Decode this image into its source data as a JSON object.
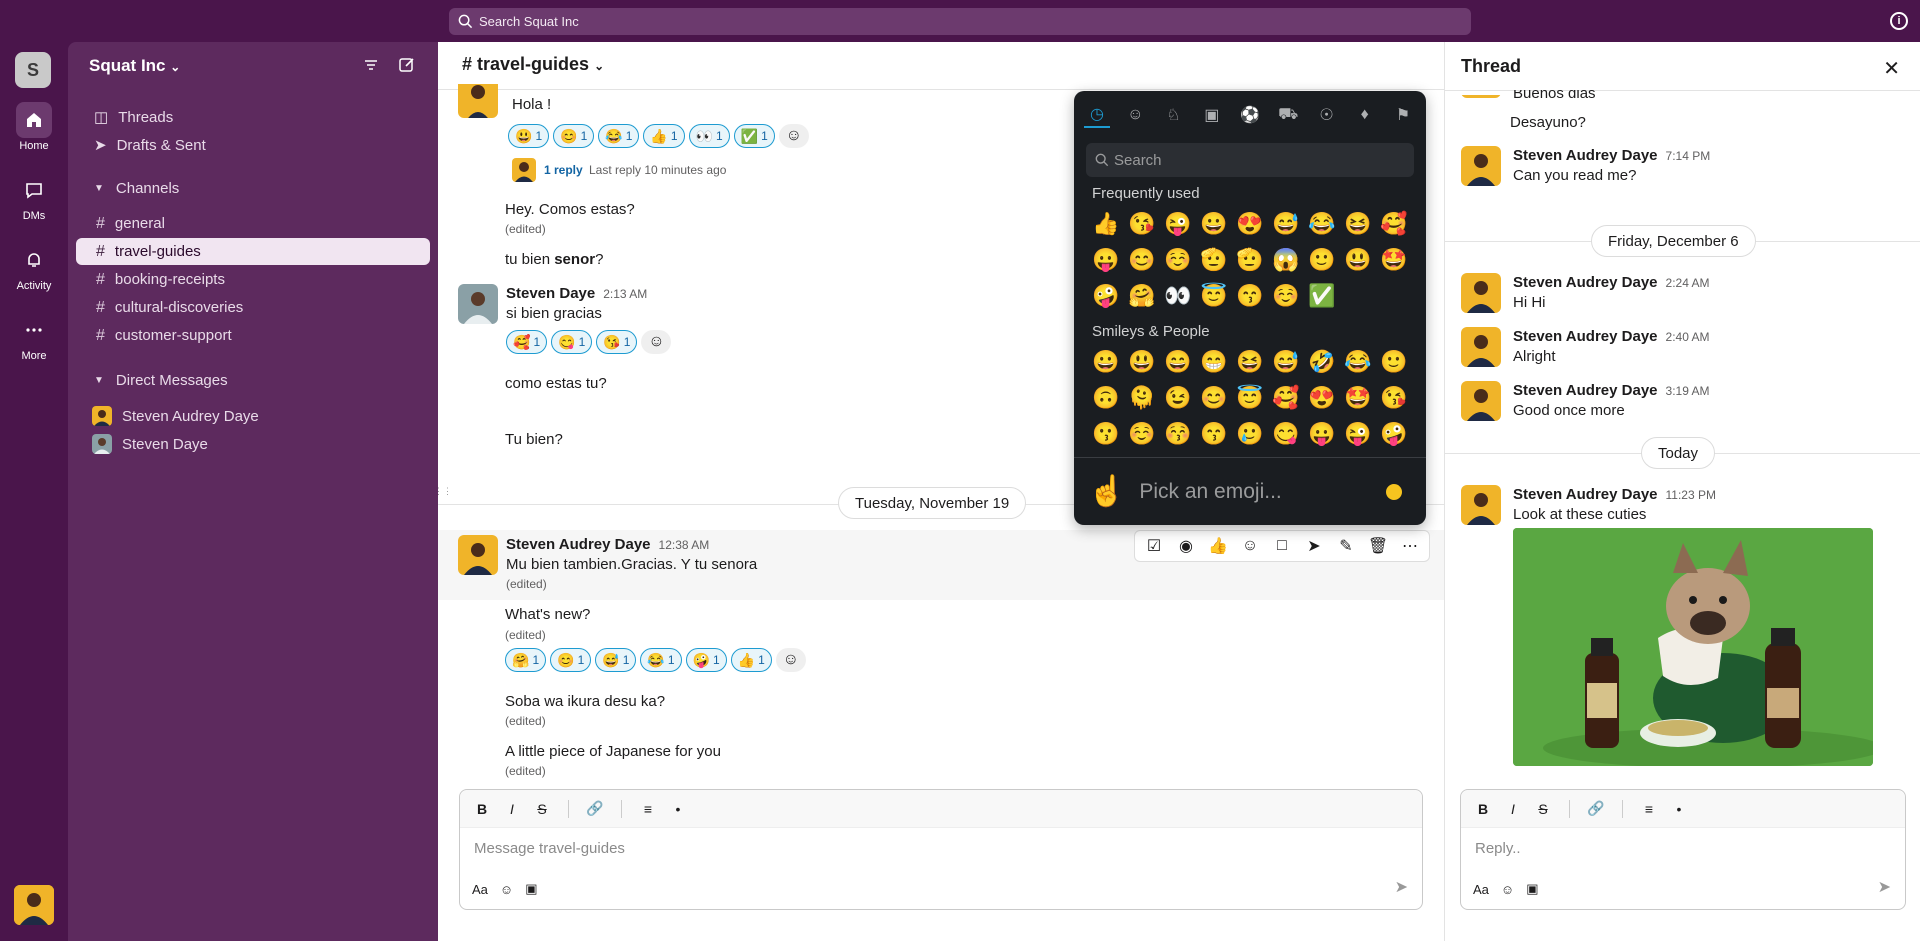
{
  "search": {
    "placeholder": "Search Squat Inc"
  },
  "rail": {
    "workspace_initial": "S",
    "items": [
      {
        "label": "Home"
      },
      {
        "label": "DMs"
      },
      {
        "label": "Activity"
      },
      {
        "label": "More"
      }
    ]
  },
  "sidebar": {
    "workspace": "Squat Inc",
    "nav": [
      {
        "label": "Threads"
      },
      {
        "label": "Drafts & Sent"
      }
    ],
    "channels_header": "Channels",
    "channels": [
      {
        "name": "general"
      },
      {
        "name": "travel-guides"
      },
      {
        "name": "booking-receipts"
      },
      {
        "name": "cultural-discoveries"
      },
      {
        "name": "customer-support"
      }
    ],
    "dm_header": "Direct Messages",
    "dms": [
      {
        "name": "Steven Audrey Daye"
      },
      {
        "name": "Steven Daye"
      }
    ]
  },
  "channel": {
    "title": "# travel-guides",
    "messages": {
      "m1_text": "Hola !",
      "m1_reactions": [
        {
          "emoji": "😃",
          "count": "1"
        },
        {
          "emoji": "😊",
          "count": "1"
        },
        {
          "emoji": "😂",
          "count": "1"
        },
        {
          "emoji": "👍",
          "count": "1"
        },
        {
          "emoji": "👀",
          "count": "1"
        },
        {
          "emoji": "✅",
          "count": "1"
        }
      ],
      "m1_reply": "1 reply",
      "m1_last_reply": "Last reply 10 minutes ago",
      "m2_text": "Hey. Comos estas?",
      "m2_edited": "(edited)",
      "m3_text_pre": "tu bien ",
      "m3_text_bold": "senor",
      "m3_text_post": "?",
      "m4_author": "Steven Daye",
      "m4_time": "2:13 AM",
      "m4_text": "si bien gracias",
      "m4_reactions": [
        {
          "emoji": "🥰",
          "count": "1"
        },
        {
          "emoji": "😋",
          "count": "1"
        },
        {
          "emoji": "😘",
          "count": "1"
        }
      ],
      "m5_text": "como estas tu?",
      "m6_text": "Tu bien?",
      "date_divider": "Tuesday, November 19",
      "m7_author": "Steven Audrey Daye",
      "m7_time": "12:38 AM",
      "m7_text": "Mu bien tambien.Gracias. Y tu senora",
      "m7_edited": "(edited)",
      "m8_text": "What's new?",
      "m8_edited": "(edited)",
      "m8_reactions": [
        {
          "emoji": "🤗",
          "count": "1"
        },
        {
          "emoji": "😊",
          "count": "1"
        },
        {
          "emoji": "😅",
          "count": "1"
        },
        {
          "emoji": "😂",
          "count": "1"
        },
        {
          "emoji": "🤪",
          "count": "1"
        },
        {
          "emoji": "👍",
          "count": "1"
        }
      ],
      "m9_text": "Soba wa ikura desu ka?",
      "m9_edited": "(edited)",
      "m10_text": "A little piece of Japanese for you",
      "m10_edited": "(edited)"
    },
    "composer_placeholder": "Message travel-guides"
  },
  "thread": {
    "title": "Thread",
    "top_partial": "Buenos dias",
    "desayuno": "Desayuno?",
    "t1_author": "Steven Audrey Daye",
    "t1_time": "7:14 PM",
    "t1_text": "Can you read me?",
    "date1": "Friday, December 6",
    "t2_author": "Steven Audrey Daye",
    "t2_time": "2:24 AM",
    "t2_text": "Hi Hi",
    "t3_author": "Steven Audrey Daye",
    "t3_time": "2:40 AM",
    "t3_text": "Alright",
    "t4_author": "Steven Audrey Daye",
    "t4_time": "3:19 AM",
    "t4_text": "Good once more",
    "date2": "Today",
    "t5_author": "Steven Audrey Daye",
    "t5_time": "11:23 PM",
    "t5_text": "Look at these cuties",
    "reply_placeholder": "Reply.."
  },
  "emoji_picker": {
    "search_placeholder": "Search",
    "frequent_label": "Frequently used",
    "frequent": [
      "👍",
      "😘",
      "😜",
      "😀",
      "😍",
      "😅",
      "😂",
      "😆",
      "🥰",
      "😛",
      "😊",
      "☺️",
      "🫡",
      "🫡",
      "😱",
      "🙂",
      "😃",
      "🤩",
      "🤪",
      "🤗",
      "👀",
      "😇",
      "😙",
      "☺️",
      "✅"
    ],
    "smileys_label": "Smileys & People",
    "smileys": [
      "😀",
      "😃",
      "😄",
      "😁",
      "😆",
      "😅",
      "🤣",
      "😂",
      "🙂",
      "🙃",
      "🫠",
      "😉",
      "😊",
      "😇",
      "🥰",
      "😍",
      "🤩",
      "😘",
      "😗",
      "☺️",
      "😚",
      "😙",
      "🥲",
      "😋",
      "😛",
      "😜",
      "🤪"
    ],
    "footer_placeholder": "Pick an emoji..."
  }
}
